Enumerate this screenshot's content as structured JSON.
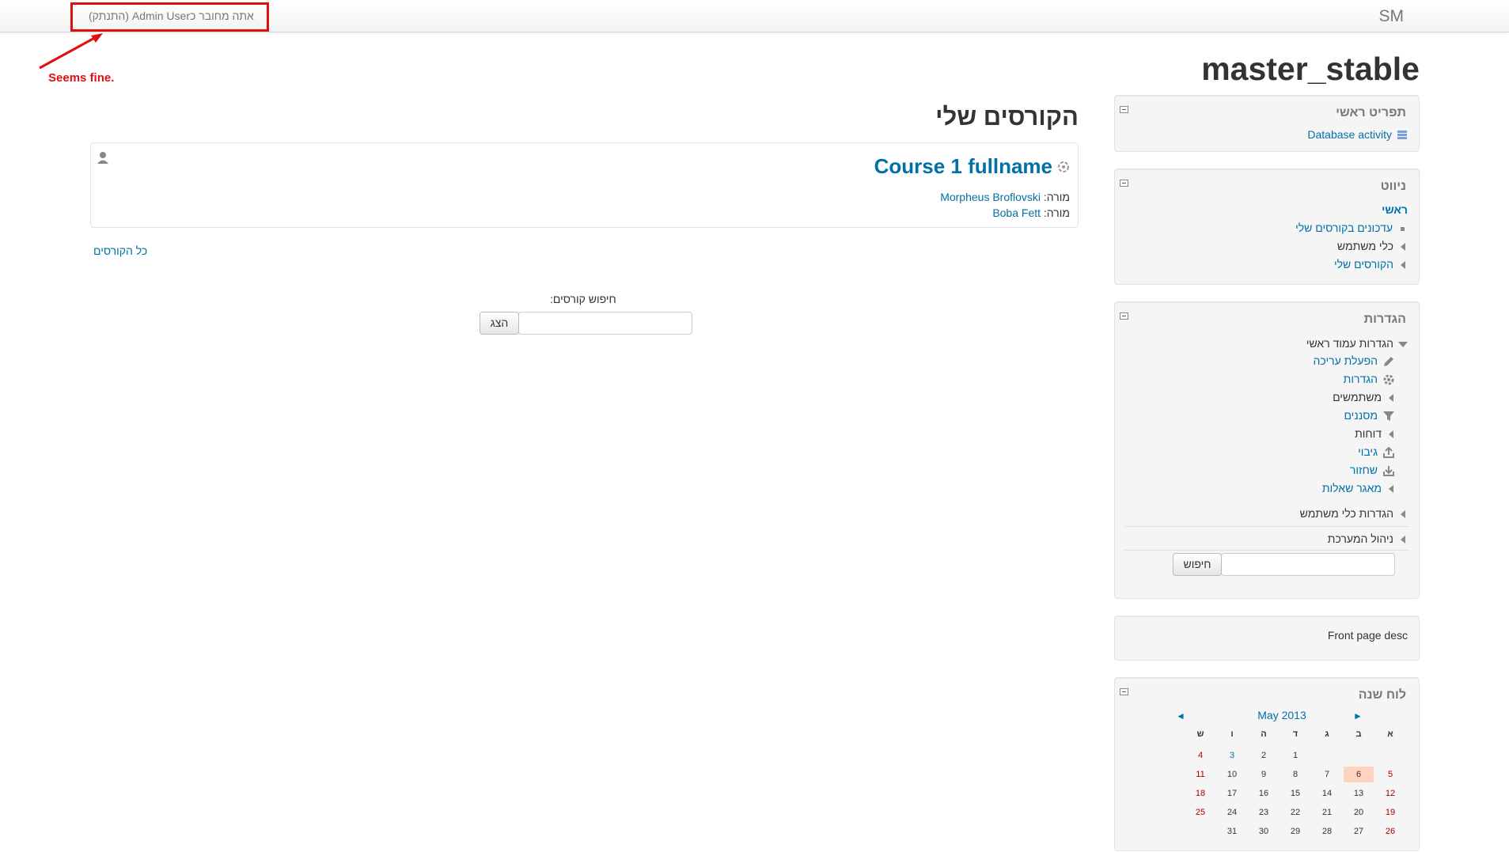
{
  "navbar": {
    "brand": "SM",
    "login_prefix": "אתה מחובר כ",
    "login_user": "Admin User",
    "logout_label": "(התנתק)"
  },
  "annotation": {
    "text": "Seems fine.",
    "color": "#e01010"
  },
  "site_title": "master_stable",
  "main_menu": {
    "title": "תפריט ראשי",
    "items": [
      {
        "label": "Database activity",
        "icon": "database-icon"
      }
    ]
  },
  "navigation": {
    "title": "ניווט",
    "home": "ראשי",
    "items": [
      {
        "label": "עדכונים בקורסים שלי",
        "icon": "square-bullet"
      },
      {
        "label": "כלי משתמש",
        "icon": "collapsed-arrow"
      },
      {
        "label": "הקורסים שלי",
        "icon": "collapsed-arrow"
      }
    ]
  },
  "settings": {
    "title": "הגדרות",
    "frontpage_settings": "הגדרות עמוד ראשי",
    "items": [
      {
        "label": "הפעלת עריכה",
        "icon": "pencil-icon"
      },
      {
        "label": "הגדרות",
        "icon": "gear-icon"
      },
      {
        "label": "משתמשים",
        "icon": "collapsed-arrow"
      },
      {
        "label": "מסננים",
        "icon": "filter-icon"
      },
      {
        "label": "דוחות",
        "icon": "collapsed-arrow"
      },
      {
        "label": "גיבוי",
        "icon": "backup-icon"
      },
      {
        "label": "שחזור",
        "icon": "restore-icon"
      },
      {
        "label": "מאגר שאלות",
        "icon": "collapsed-arrow"
      }
    ],
    "user_tools_settings": "הגדרות כלי משתמש",
    "site_admin": "ניהול המערכת",
    "search_button": "חיפוש"
  },
  "front_page_desc": "Front page desc",
  "calendar": {
    "title": "לוח שנה",
    "month": "May 2013",
    "prev": "◄",
    "next": "►",
    "day_names": [
      "א",
      "ב",
      "ג",
      "ד",
      "ה",
      "ו",
      "ש"
    ],
    "weeks": [
      [
        "",
        "",
        "",
        "1",
        "2",
        "3",
        "4"
      ],
      [
        "5",
        "6",
        "7",
        "8",
        "9",
        "10",
        "11"
      ],
      [
        "12",
        "13",
        "14",
        "15",
        "16",
        "17",
        "18"
      ],
      [
        "19",
        "20",
        "21",
        "22",
        "23",
        "24",
        "25"
      ],
      [
        "26",
        "27",
        "28",
        "29",
        "30",
        "31",
        ""
      ]
    ],
    "today": "6",
    "event_days": [
      "3"
    ],
    "colors": {
      "weekend": "#aa0000",
      "today_bg": "#ffd3bd"
    }
  },
  "main": {
    "heading": "הקורסים שלי",
    "course": {
      "name": "Course 1 fullname",
      "teacher_label": "מורה:",
      "teachers": [
        "Morpheus Broflovski",
        "Boba Fett"
      ]
    },
    "all_courses_link": "כל הקורסים",
    "search_label": "חיפוש קורסים:",
    "search_button": "הצג"
  },
  "colors": {
    "link": "#0070a8",
    "text": "#333333",
    "block_bg": "#f5f5f5"
  }
}
